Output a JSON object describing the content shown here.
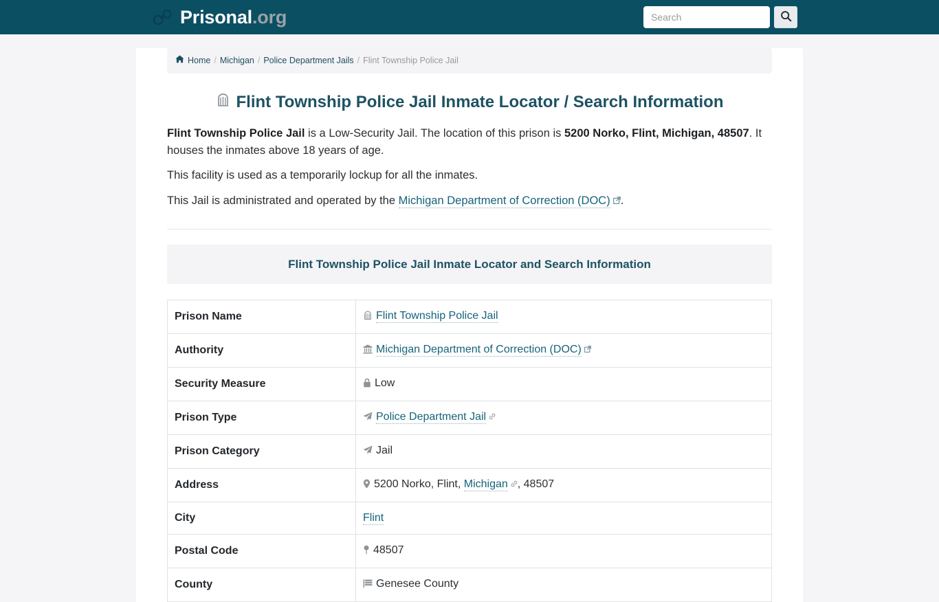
{
  "header": {
    "brand_name": "Prisonal",
    "brand_tld": ".org",
    "search_placeholder": "Search",
    "search_value": ""
  },
  "breadcrumb": {
    "items": [
      {
        "label": "Home",
        "current": false
      },
      {
        "label": "Michigan",
        "current": false
      },
      {
        "label": "Police Department Jails",
        "current": false
      },
      {
        "label": "Flint Township Police Jail",
        "current": true
      }
    ],
    "separator": "/"
  },
  "page": {
    "title": "Flint Township Police Jail Inmate Locator / Search Information",
    "paragraph1": {
      "facility_name": "Flint Township Police Jail",
      "middle": " is a Low-Security Jail. The location of this prison is ",
      "address": "5200 Norko, Flint, Michigan, 48507",
      "tail": ". It houses the inmates above 18 years of age."
    },
    "paragraph2": "This facility is used as a temporarily lockup for all the inmates.",
    "paragraph3": {
      "prefix": "This Jail is administrated and operated by the ",
      "link": "Michigan Department of Correction (DOC)",
      "suffix": "."
    }
  },
  "table": {
    "caption": "Flint Township Police Jail Inmate Locator and Search Information",
    "rows": [
      {
        "label": "Prison Name",
        "icon": "jail-gate-icon",
        "value": "Flint Township Police Jail",
        "value_is_link": true,
        "link_badge": ""
      },
      {
        "label": "Authority",
        "icon": "bank-icon",
        "value": "Michigan Department of Correction (DOC)",
        "value_is_link": true,
        "link_badge": "external-link-icon"
      },
      {
        "label": "Security Measure",
        "icon": "lock-icon",
        "value": "Low",
        "value_is_link": false,
        "link_badge": ""
      },
      {
        "label": "Prison Type",
        "icon": "paper-plane-icon",
        "value": "Police Department Jail",
        "value_is_link": true,
        "link_badge": "chain-link-icon"
      },
      {
        "label": "Prison Category",
        "icon": "paper-plane-icon",
        "value": "Jail",
        "value_is_link": false,
        "link_badge": ""
      },
      {
        "label": "Address",
        "icon": "map-pin-icon",
        "value": "5200 Norko, Flint, Michigan, 48507",
        "value_is_link": false,
        "link_badge": "chain-link-icon",
        "address_parts": {
          "before": "5200 Norko, Flint, ",
          "link": "Michigan",
          "after": ", 48507"
        }
      },
      {
        "label": "City",
        "icon": "",
        "value": "Flint",
        "value_is_link": true,
        "link_badge": ""
      },
      {
        "label": "Postal Code",
        "icon": "thumbtack-icon",
        "value": "48507",
        "value_is_link": false,
        "link_badge": ""
      },
      {
        "label": "County",
        "icon": "flag-icon",
        "value": "Genesee County",
        "value_is_link": false,
        "link_badge": ""
      }
    ]
  },
  "colors": {
    "header_bg": "#0b4f63",
    "brand_white": "#ffffff",
    "brand_gray": "#9aa3a6",
    "heading_teal": "#1d5264",
    "link_teal": "#16637a",
    "page_bg": "#f5f5f7",
    "panel_bg": "#f4f4f6",
    "icon_gray": "#8d9499",
    "table_border": "#dfe2e5"
  }
}
